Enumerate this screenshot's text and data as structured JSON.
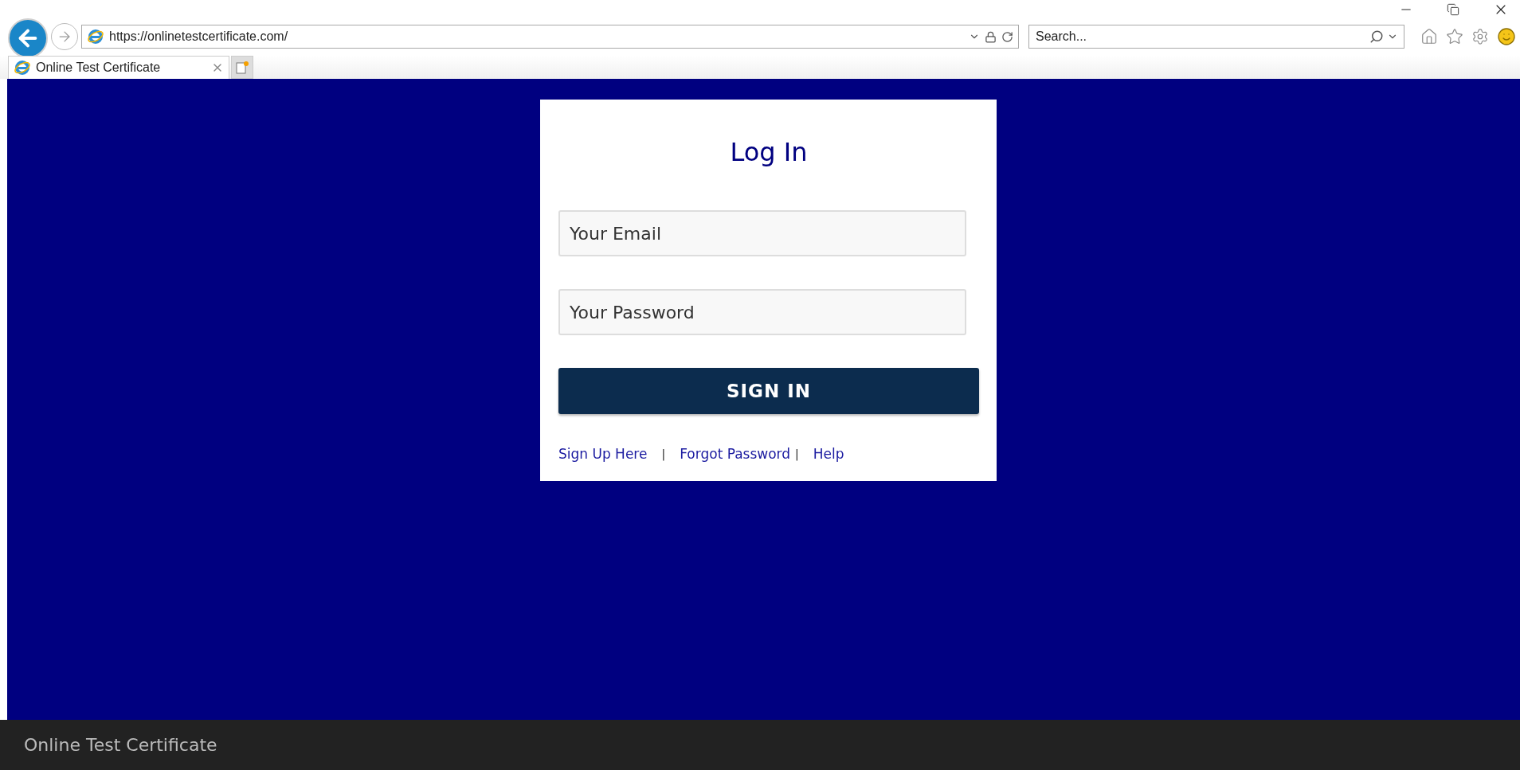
{
  "browser": {
    "address": "https://onlinetestcertificate.com/",
    "search": {
      "placeholder": "Search..."
    },
    "tabs": [
      {
        "label": "Online Test Certificate",
        "selected": true
      }
    ]
  },
  "login": {
    "title": "Log In",
    "fields": [
      {
        "placeholder": "Your Email"
      },
      {
        "placeholder": "Your Password"
      }
    ],
    "button": "SIGN IN",
    "links": [
      {
        "kind": "link",
        "label": "Sign Up Here"
      },
      {
        "kind": "separator",
        "label": "|"
      },
      {
        "kind": "link",
        "label": "Forgot Password"
      },
      {
        "kind": "separator",
        "label": "|"
      },
      {
        "kind": "link",
        "label": "Help"
      }
    ]
  },
  "footer": {
    "title": "Online Test Certificate"
  }
}
